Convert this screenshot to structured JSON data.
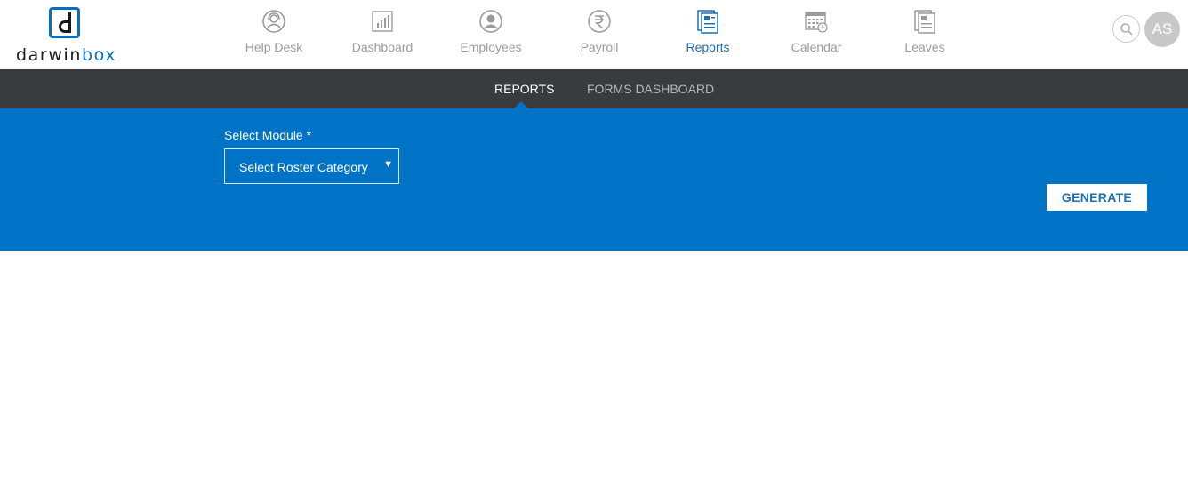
{
  "brand": {
    "name_part1": "darwin",
    "name_part2": "box",
    "accent_color": "#0a6ebd"
  },
  "nav": {
    "items": [
      {
        "label": "Help Desk",
        "icon": "headset-user-icon",
        "active": false
      },
      {
        "label": "Dashboard",
        "icon": "bar-chart-icon",
        "active": false
      },
      {
        "label": "Employees",
        "icon": "user-circle-icon",
        "active": false
      },
      {
        "label": "Payroll",
        "icon": "rupee-icon",
        "active": false
      },
      {
        "label": "Reports",
        "icon": "report-document-icon",
        "active": true
      },
      {
        "label": "Calendar",
        "icon": "calendar-icon",
        "active": false
      },
      {
        "label": "Leaves",
        "icon": "leave-document-icon",
        "active": false
      }
    ]
  },
  "header": {
    "search_icon": "search-icon",
    "avatar_initials": "AS"
  },
  "subnav": {
    "tabs": [
      {
        "label": "REPORTS",
        "active": true
      },
      {
        "label": "FORMS DASHBOARD",
        "active": false
      }
    ]
  },
  "form": {
    "module_label": "Select Module",
    "required_marker": "*",
    "module_select_value": "Select Roster Category",
    "generate_label": "GENERATE"
  },
  "colors": {
    "panel_blue": "#0073c6",
    "subnav_dark": "#393b3e",
    "nav_inactive": "#9b9b9b",
    "nav_active": "#1f6fb5"
  }
}
